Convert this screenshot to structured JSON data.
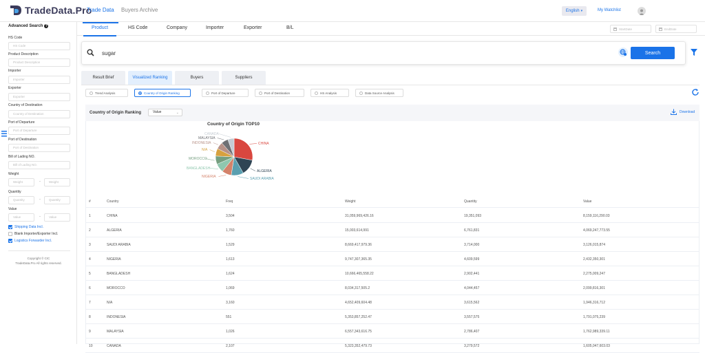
{
  "brand": {
    "name": "TradeData.Pro",
    "colors": {
      "accent": "#1a73e8",
      "logo_dark": "#3a3a5a",
      "logo_blue": "#4aa3e8"
    }
  },
  "top_nav": {
    "tabs": [
      "Trade Data",
      "Buyers Archive"
    ],
    "active": "Trade Data",
    "language": "English",
    "watchlist": "My Watchlist",
    "avatar_icon": "user-avatar-icon"
  },
  "sidebar": {
    "title": "Advanced Search",
    "fields": [
      {
        "label": "HS Code",
        "placeholder": "HS Code"
      },
      {
        "label": "Product Description",
        "placeholder": "Product Description"
      },
      {
        "label": "Importer",
        "placeholder": "Importer"
      },
      {
        "label": "Exporter",
        "placeholder": "Exporter"
      },
      {
        "label": "Country of Destination",
        "placeholder": "Country of Destination"
      },
      {
        "label": "Port of Departure",
        "placeholder": "Port of Departure"
      },
      {
        "label": "Port of Destination",
        "placeholder": "Port of Destination"
      },
      {
        "label": "Bill of Lading NO.",
        "placeholder": "Bill of Lading NO."
      }
    ],
    "ranges": [
      {
        "label": "Weight",
        "from": "Weight",
        "to": "Weight"
      },
      {
        "label": "Quantity",
        "from": "Quantity",
        "to": "Quantity"
      },
      {
        "label": "Value",
        "from": "Value",
        "to": "Value"
      }
    ],
    "checks": [
      {
        "label": "Shipping Data Incl.",
        "checked": true
      },
      {
        "label": "Blank Importer/Exporter Incl.",
        "checked": false
      },
      {
        "label": "Logistics Forwarder Incl.",
        "checked": true
      }
    ],
    "copyright": "Copyright © CIC",
    "rights": "TradeData.Pro All rights reserved."
  },
  "category_tabs": {
    "items": [
      "Product",
      "HS Code",
      "Company",
      "Importer",
      "Exporter",
      "B/L"
    ],
    "active": "Product"
  },
  "dates": {
    "start": "StartDate",
    "end": "EndDate"
  },
  "search": {
    "value": "sugar",
    "button": "Search"
  },
  "view_tabs": {
    "items": [
      "Result Brief",
      "Visualized Ranking",
      "Buyers",
      "Suppliers"
    ],
    "active": "Visualized Ranking"
  },
  "analysis": {
    "items": [
      "Trend Analysis",
      "Country of Origin Ranking",
      "Port of Departure",
      "Port of Destination",
      "HS Analysis",
      "Data Source Analysis"
    ],
    "active": "Country of Origin Ranking"
  },
  "ranking": {
    "title": "Country of Origin Ranking",
    "metric": "Value",
    "download": "Download"
  },
  "chart_data": {
    "type": "pie",
    "title": "Country of Origin TOP10",
    "categories": [
      "CHINA",
      "ALGERIA",
      "SAUDI ARABIA",
      "NIGERIA",
      "BANGLADESH",
      "MOROCCO",
      "N/A",
      "INDONESIA",
      "MALAYSIA",
      "CANADA"
    ],
    "values": [
      8159116290.03,
      4069247773.55,
      3126015874,
      2432350301,
      2275009247,
      2099816301,
      1946316712,
      1791075239,
      1762989339.11,
      1605047603.03
    ],
    "colors": [
      "#d9473f",
      "#2f4554",
      "#5a9fb0",
      "#d4826a",
      "#8fc7ae",
      "#759f80",
      "#d7a13e",
      "#b89288",
      "#6e7074",
      "#c4ccd3"
    ]
  },
  "table": {
    "columns": [
      "#",
      "Country",
      "Freq",
      "Weight",
      "Quantity",
      "Value"
    ],
    "rows": [
      [
        "1",
        "CHINA",
        "3,504",
        "31,059,969,426.16",
        "19,351,093",
        "8,159,116,290.03"
      ],
      [
        "2",
        "ALGERIA",
        "1,760",
        "15,003,614,991",
        "6,761,831",
        "4,069,247,773.55"
      ],
      [
        "3",
        "SAUDI ARABIA",
        "1,529",
        "8,669,417,979.36",
        "3,714,000",
        "3,126,015,874"
      ],
      [
        "4",
        "NIGERIA",
        "1,613",
        "9,747,307,365.35",
        "4,609,599",
        "2,432,350,301"
      ],
      [
        "5",
        "BANGLADESH",
        "1,624",
        "10,666,465,558.22",
        "2,902,441",
        "2,275,009,247"
      ],
      [
        "6",
        "MOROCCO",
        "1,069",
        "8,034,317,505.2",
        "4,044,457",
        "2,099,816,301"
      ],
      [
        "7",
        "N/A",
        "3,160",
        "4,652,409,604.48",
        "3,615,562",
        "1,946,316,712"
      ],
      [
        "8",
        "INDONESIA",
        "551",
        "5,353,857,252.47",
        "3,557,575",
        "1,791,075,239"
      ],
      [
        "9",
        "MALAYSIA",
        "1,026",
        "6,557,343,616.75",
        "2,786,407",
        "1,762,989,339.11"
      ],
      [
        "10",
        "CANADA",
        "2,107",
        "5,323,352,479.73",
        "3,279,572",
        "1,605,047,603.03"
      ]
    ]
  }
}
